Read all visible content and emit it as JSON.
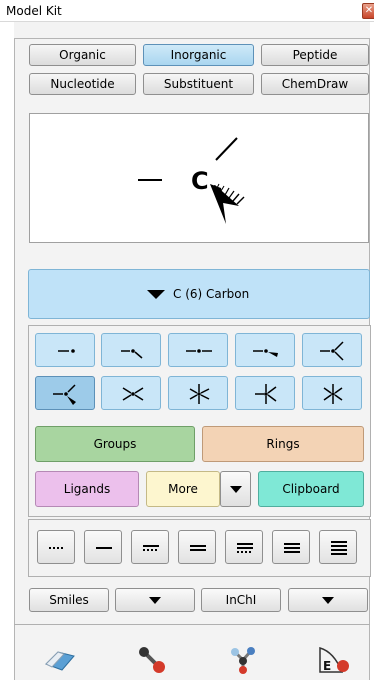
{
  "window": {
    "title": "Model Kit",
    "close_icon": "close-icon"
  },
  "tabs": {
    "row1": [
      "Organic",
      "Inorganic",
      "Peptide"
    ],
    "row2": [
      "Nucleotide",
      "Substituent",
      "ChemDraw"
    ],
    "active": "Inorganic"
  },
  "preview": {
    "atom_symbol": "C"
  },
  "element_selector": {
    "label": "C (6) Carbon"
  },
  "geometry_buttons": [
    "monovalent-icon",
    "bent-icon",
    "linear-icon",
    "trigonal-planar-icon",
    "trigonal-icon",
    "tetrahedral-icon",
    "seesaw-icon",
    "trigonal-bipyramidal-icon",
    "square-pyramidal-icon",
    "octahedral-icon"
  ],
  "selected_geometry": "tetrahedral-icon",
  "category_buttons": {
    "groups": "Groups",
    "rings": "Rings",
    "ligands": "Ligands",
    "more": "More",
    "clipboard": "Clipboard"
  },
  "colors": {
    "groups": "#a8d5a0",
    "rings": "#f3d3b5",
    "ligands": "#ecc0ec",
    "more": "#fdf6cf",
    "clipboard": "#7fe8d6",
    "geometry": "#c9e6f8",
    "element": "#bfe2f8"
  },
  "bond_buttons": [
    "partial-bond-icon",
    "single-bond-icon",
    "one-and-half-bond-icon",
    "double-bond-icon",
    "two-and-half-bond-icon",
    "triple-bond-icon",
    "quadruple-bond-icon"
  ],
  "format_buttons": {
    "smiles": "Smiles",
    "inchi": "InChI"
  },
  "tools": [
    "eraser-icon",
    "bond-tool-icon",
    "molecule-tool-icon",
    "element-table-icon"
  ]
}
